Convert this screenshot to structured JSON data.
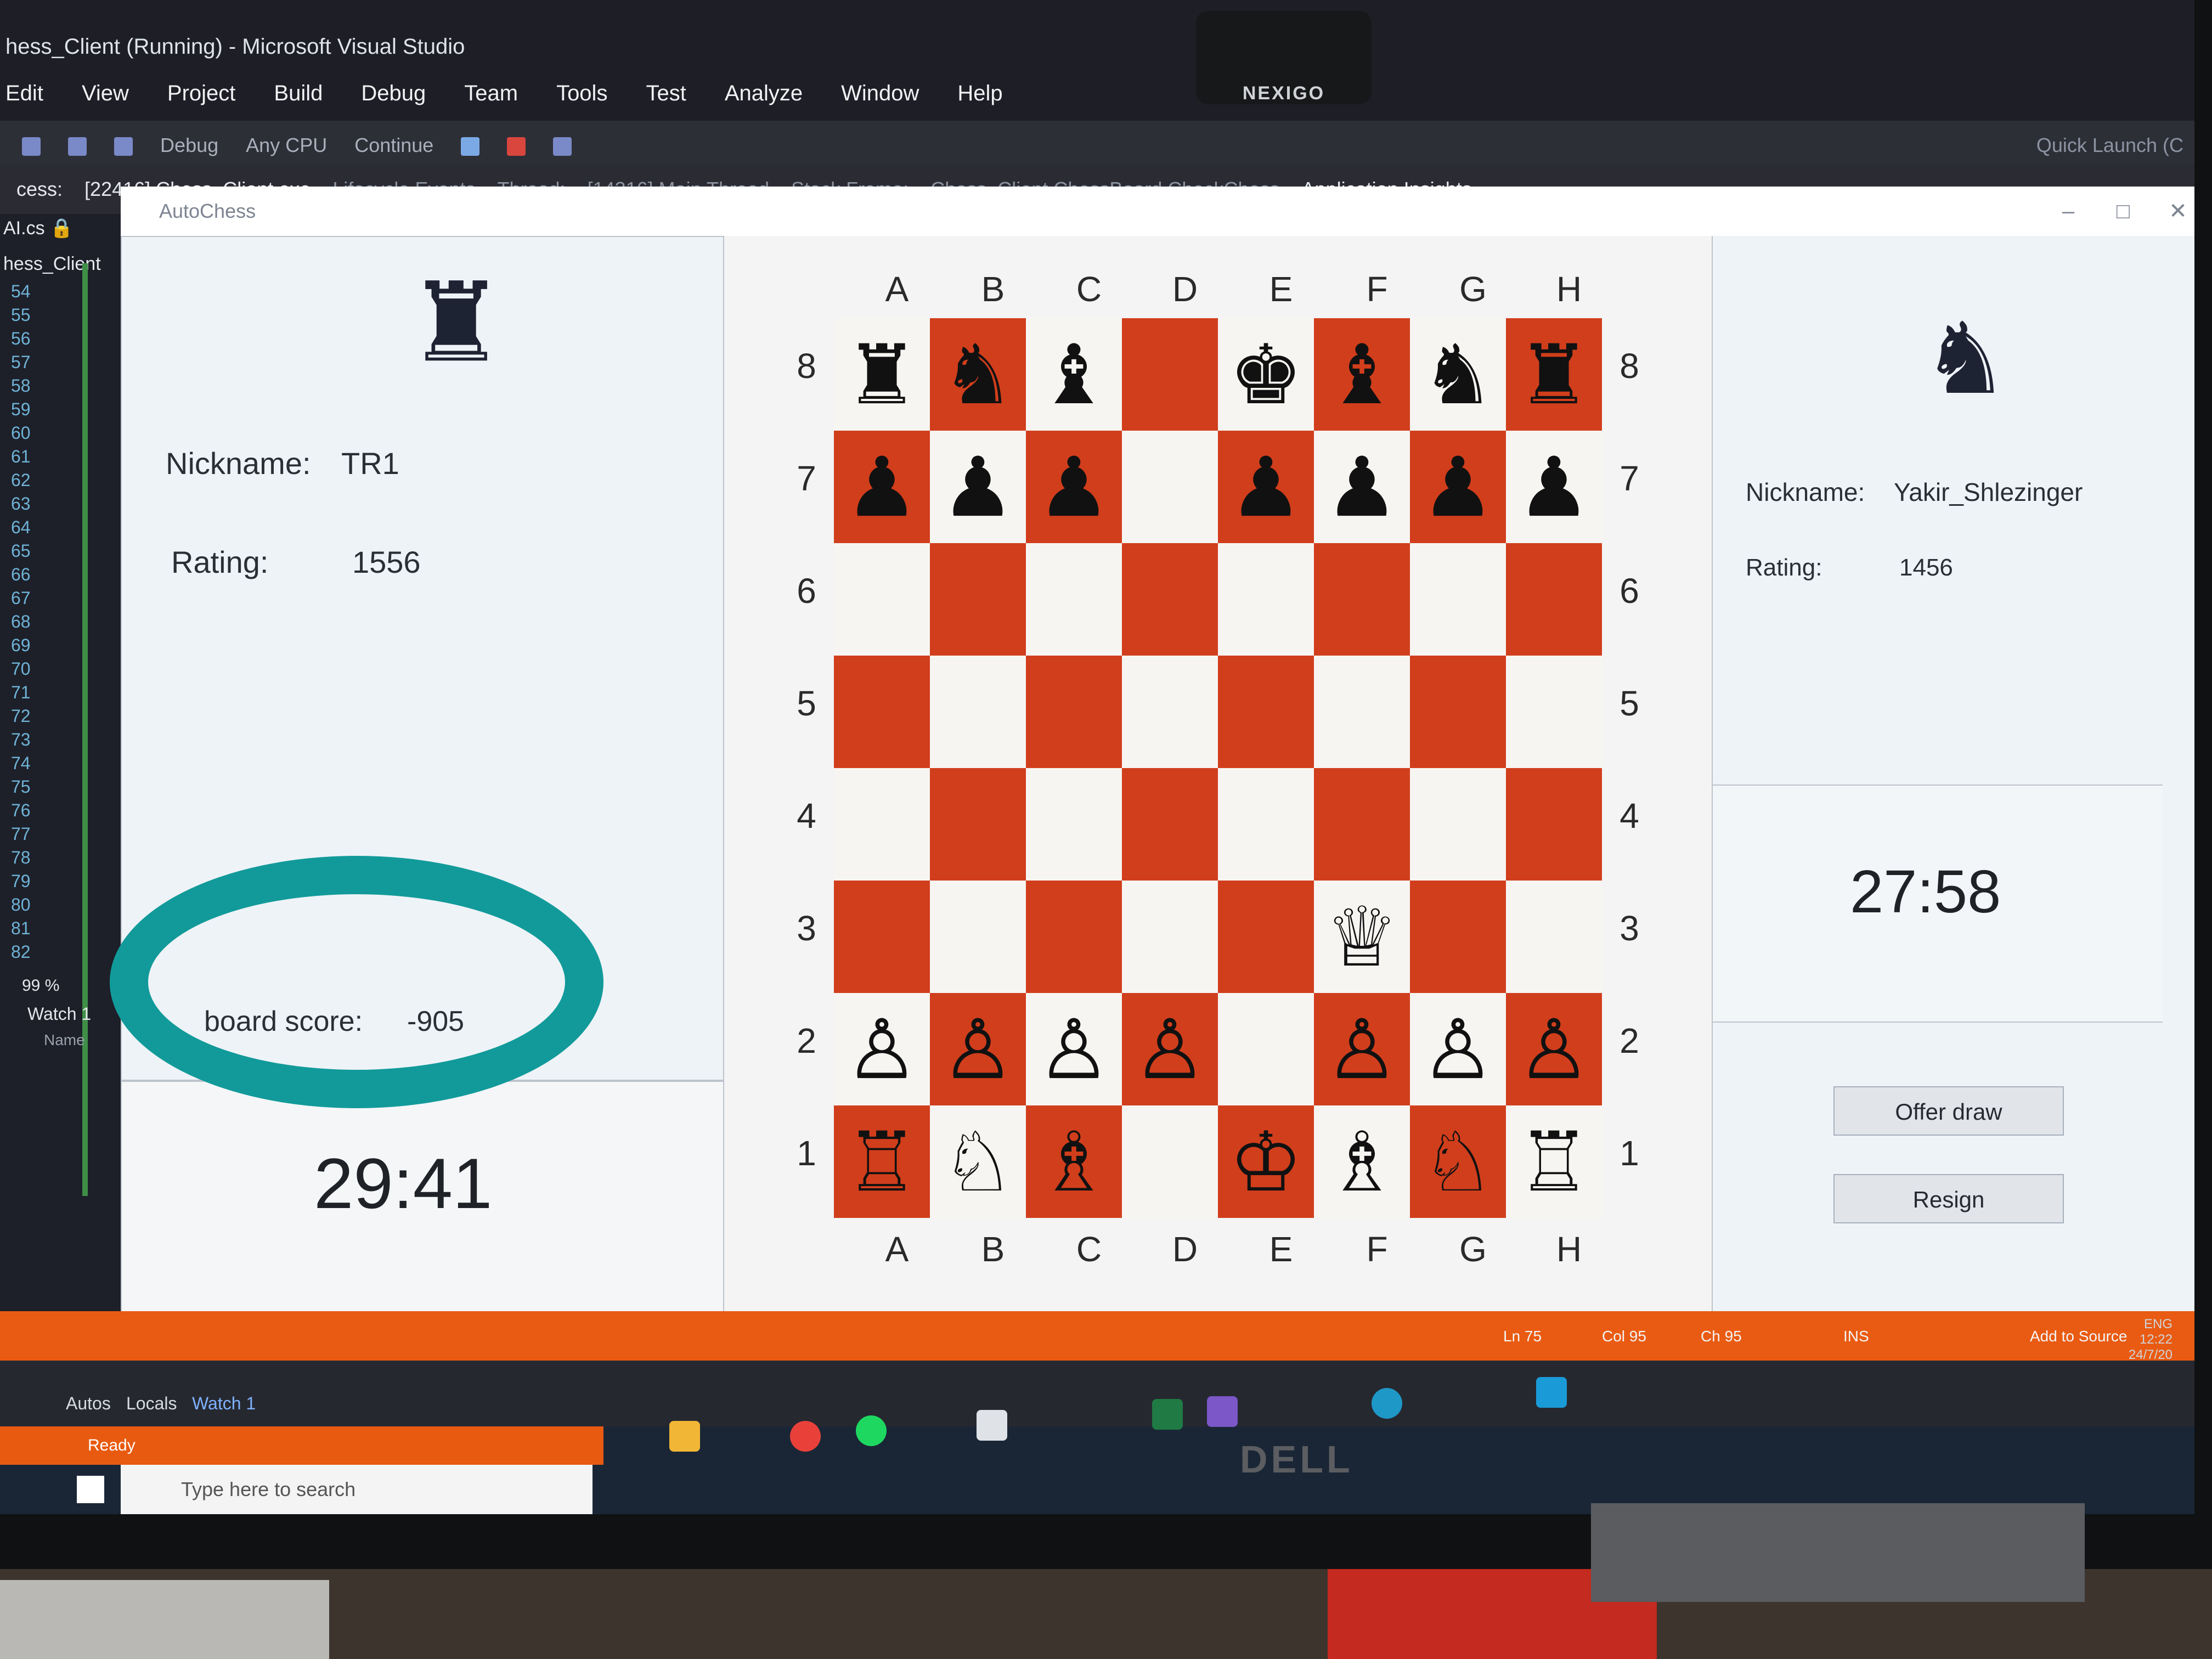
{
  "vs": {
    "title": "hess_Client (Running) - Microsoft Visual Studio",
    "menu": [
      "Edit",
      "View",
      "Project",
      "Build",
      "Debug",
      "Team",
      "Tools",
      "Test",
      "Analyze",
      "Window",
      "Help"
    ],
    "toolbar": {
      "config": "Debug",
      "platform": "Any CPU",
      "continue": "Continue",
      "quick_launch": "Quick Launch (C"
    },
    "debug_bar": {
      "process_label": "cess:",
      "process": "[22416] Chess_Client.exe",
      "lifecycle": "Lifecycle Events",
      "thread_label": "Thread:",
      "thread": "[14316] Main Thread",
      "stack_label": "Stack Frame:",
      "stack": "Chess_Client.ChessBoard.CheckChess",
      "insights": "Application Insights"
    },
    "file_tab": "AI.cs",
    "project": "hess_Client",
    "line_numbers": [
      "54",
      "55",
      "56",
      "57",
      "58",
      "59",
      "60",
      "61",
      "62",
      "63",
      "64",
      "65",
      "66",
      "67",
      "68",
      "69",
      "70",
      "71",
      "72",
      "73",
      "74",
      "75",
      "76",
      "77",
      "78",
      "79",
      "80",
      "81",
      "82"
    ],
    "zoom": "99 %",
    "watch_title": "Watch 1",
    "watch_col": "Name",
    "status": {
      "ln": "Ln 75",
      "col": "Col 95",
      "ch": "Ch 95",
      "ins": "INS",
      "add_to_source": "Add to Source"
    },
    "bottom_tabs": [
      "Autos",
      "Locals",
      "Watch 1"
    ],
    "ready": "Ready"
  },
  "window": {
    "title": "AutoChess"
  },
  "webcam_label": "NEXIGO",
  "monitor_brand": "DELL",
  "left_player": {
    "piece_icon": "rook-icon",
    "piece_glyph": "♜",
    "nickname_label": "Nickname:",
    "nickname": "TR1",
    "rating_label": "Rating:",
    "rating": "1556",
    "board_score_label": "board score:",
    "board_score": "-905",
    "timer": "29:41"
  },
  "right_player": {
    "piece_icon": "knight-icon",
    "piece_glyph": "♞",
    "nickname_label": "Nickname:",
    "nickname": "Yakir_Shlezinger",
    "rating_label": "Rating:",
    "rating": "1456",
    "timer": "27:58",
    "offer_draw": "Offer draw",
    "resign": "Resign"
  },
  "board": {
    "files": [
      "A",
      "B",
      "C",
      "D",
      "E",
      "F",
      "G",
      "H"
    ],
    "ranks": [
      "8",
      "7",
      "6",
      "5",
      "4",
      "3",
      "2",
      "1"
    ],
    "rows": [
      [
        "♜",
        "♞",
        "♝",
        "",
        "♚",
        "♝",
        "♞",
        "♜"
      ],
      [
        "♟",
        "♟",
        "♟",
        "",
        "♟",
        "♟",
        "♟",
        "♟"
      ],
      [
        "",
        "",
        "",
        "",
        "",
        "",
        "",
        ""
      ],
      [
        "",
        "",
        "",
        "",
        "",
        "",
        "",
        ""
      ],
      [
        "",
        "",
        "",
        "",
        "",
        "",
        "",
        ""
      ],
      [
        "",
        "",
        "",
        "",
        "",
        "♕",
        "",
        ""
      ],
      [
        "♙",
        "♙",
        "♙",
        "♙",
        "",
        "♙",
        "♙",
        "♙"
      ],
      [
        "♖",
        "♘",
        "♗",
        "",
        "♔",
        "♗",
        "♘",
        "♖"
      ]
    ],
    "light_color": "#f7f5f2",
    "dark_color": "#d13e1c"
  },
  "taskbar": {
    "search_placeholder": "Type here to search",
    "tray_lang": "ENG",
    "tray_time": "12:22",
    "tray_date": "24/7/20"
  },
  "annotation_color": "#129a9a"
}
